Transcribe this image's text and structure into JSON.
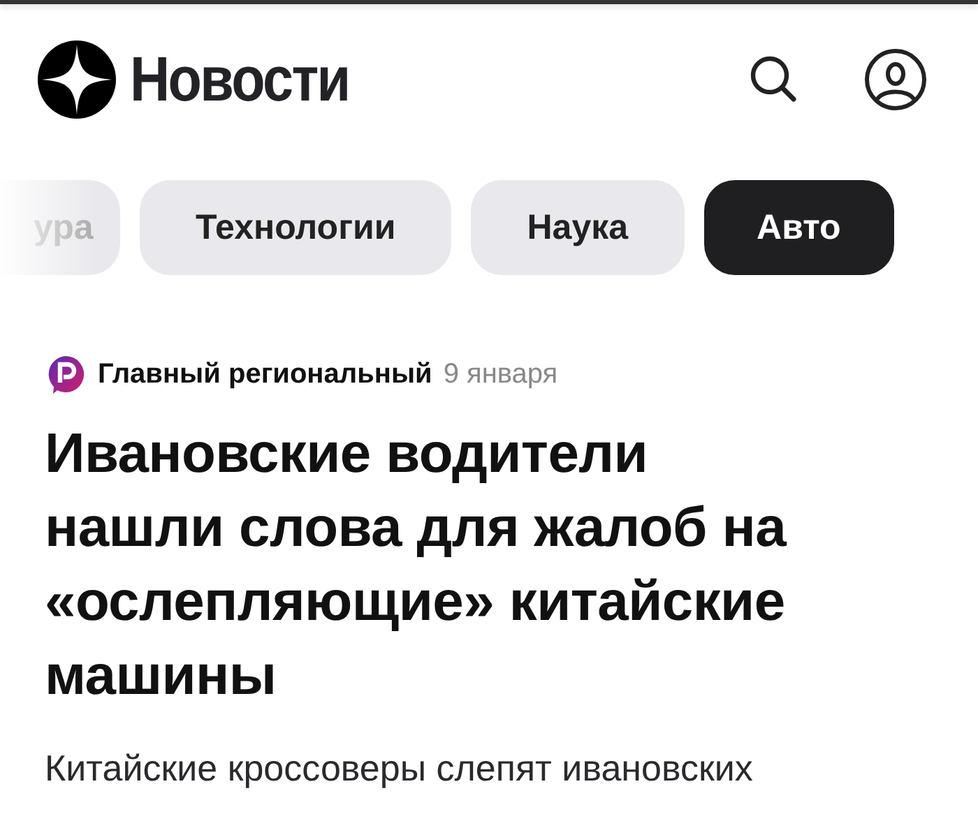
{
  "header": {
    "title": "Новости"
  },
  "categories": [
    {
      "label": "ура",
      "selected": false
    },
    {
      "label": "Технологии",
      "selected": false
    },
    {
      "label": "Наука",
      "selected": false
    },
    {
      "label": "Авто",
      "selected": true
    }
  ],
  "article": {
    "source": "Главный региональный",
    "date": "9 января",
    "headline": "Ивановские водители нашли слова для жалоб на «ослепляющие» китайские машины",
    "snippet": "Китайские кроссоверы слепят ивановских"
  }
}
